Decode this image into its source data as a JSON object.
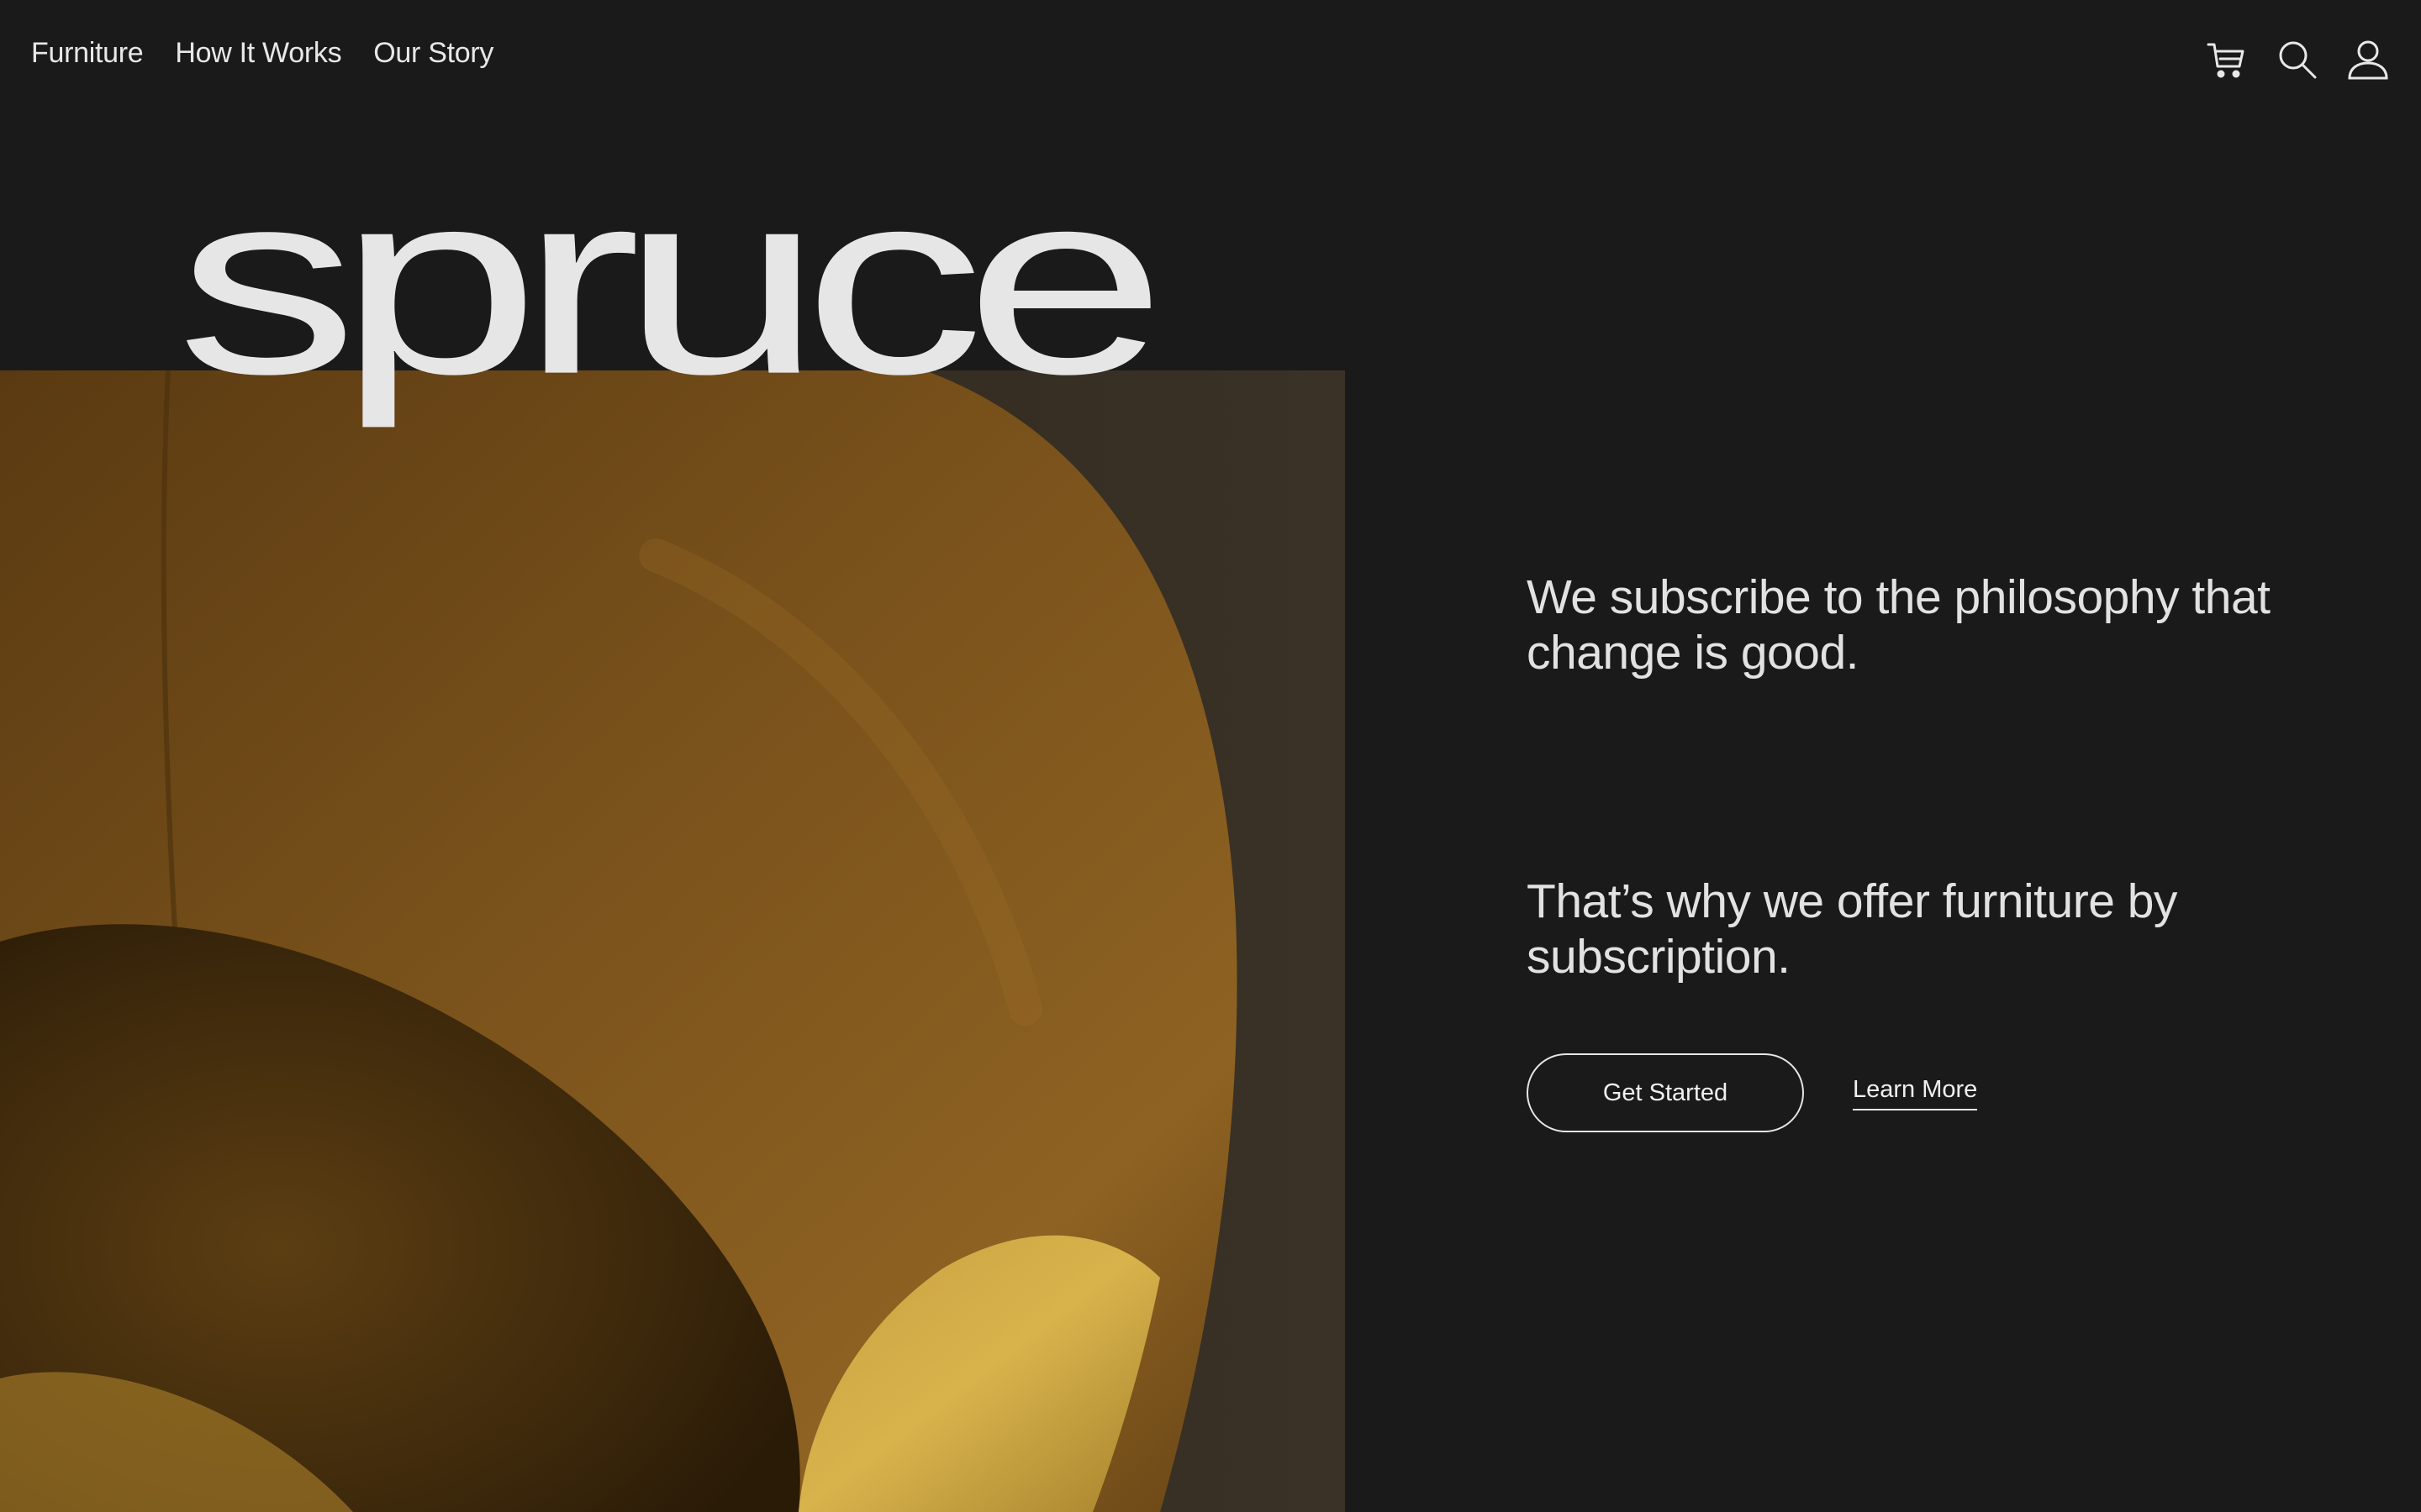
{
  "nav": {
    "links": [
      "Furniture",
      "How It Works",
      "Our Story"
    ],
    "icons": [
      "cart-icon",
      "search-icon",
      "account-icon"
    ]
  },
  "brand": {
    "wordmark": "spruce"
  },
  "hero": {
    "image": "mustard-armchair-photo",
    "tagline_1": "We subscribe to the philosophy that change is good.",
    "tagline_2": "That’s why we offer furniture by subscription.",
    "cta_primary": "Get Started",
    "cta_secondary": "Learn More"
  },
  "colors": {
    "background": "#1a1a1a",
    "text": "#e4e4e4",
    "chair": "#8a5d1c",
    "chair_highlight": "#d2ad48"
  }
}
